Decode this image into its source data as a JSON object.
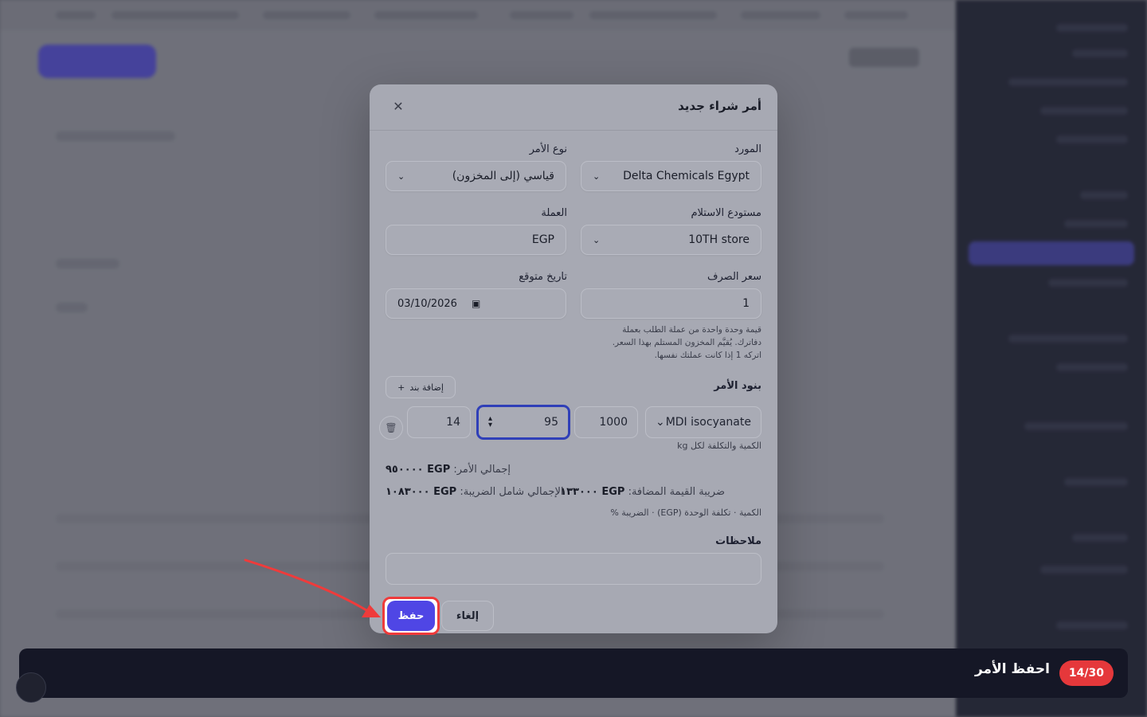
{
  "modal": {
    "title": "أمر شراء جديد",
    "close_icon": "close-icon",
    "supplier": {
      "label": "المورد",
      "value": "Delta Chemicals Egypt"
    },
    "order_type": {
      "label": "نوع الأمر",
      "value": "قياسي (إلى المخزون)"
    },
    "warehouse": {
      "label": "مستودع الاستلام",
      "value": "10TH store"
    },
    "currency": {
      "label": "العملة",
      "value": "EGP"
    },
    "exchange_rate": {
      "label": "سعر الصرف",
      "value": "1",
      "hint_1": "قيمة وحدة واحدة من عملة الطلب بعملة",
      "hint_2": "دفاترك. يُقيَّم المخزون المستلم بهذا السعر.",
      "hint_3": "اتركه 1 إذا كانت عملتك نفسها."
    },
    "expected_date": {
      "label": "تاريخ متوقع",
      "value": "03/10/2026"
    },
    "items": {
      "label": "بنود الأمر",
      "add_label": "إضافة بند",
      "product": "MDI isocyanate",
      "quantity": "1000",
      "unit_cost": "95",
      "tax": "14",
      "hint": "الكمية والتكلفة لكل kg"
    },
    "totals": {
      "order_total_label": "إجمالي الأمر:",
      "order_total_value": "EGP ٩٥٠٠٠٠",
      "vat_label": "ضريبة القيمة المضافة:",
      "vat_value": "EGP ١٣٣٠٠٠",
      "grand_label": "الإجمالي شامل الضريبة:",
      "grand_value": "EGP ١٠٨٣٠٠٠",
      "columns_hint": "الكمية · تكلفة الوحدة (EGP) · الضريبة %"
    },
    "notes": {
      "label": "ملاحظات",
      "value": ""
    },
    "save_label": "حفظ",
    "cancel_label": "إلغاء"
  },
  "tour": {
    "step": "14/30",
    "text": "احفظ الأمر"
  },
  "colors": {
    "accent": "#4f46e5",
    "highlight": "#ef3b3b",
    "badge": "#e5383b",
    "tour_bg": "#151726"
  }
}
